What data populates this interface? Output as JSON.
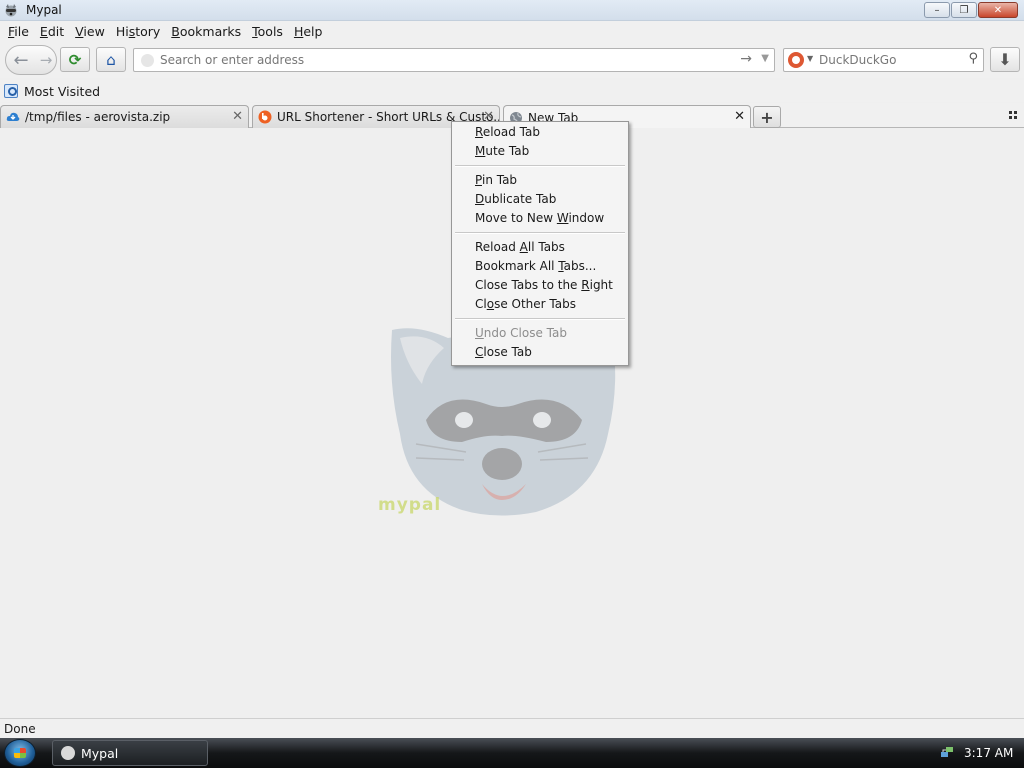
{
  "window": {
    "title": "Mypal",
    "buttons": {
      "minimize": "–",
      "restore": "❐",
      "close": "✕"
    }
  },
  "menubar": {
    "items": [
      {
        "label": "File",
        "mnemonic": "F",
        "rest": "ile"
      },
      {
        "label": "Edit",
        "mnemonic": "E",
        "rest": "dit"
      },
      {
        "label": "View",
        "mnemonic": "V",
        "rest": "iew"
      },
      {
        "label": "History",
        "pre": "Hi",
        "mnemonic": "s",
        "rest": "tory"
      },
      {
        "label": "Bookmarks",
        "mnemonic": "B",
        "rest": "ookmarks"
      },
      {
        "label": "Tools",
        "mnemonic": "T",
        "rest": "ools"
      },
      {
        "label": "Help",
        "mnemonic": "H",
        "rest": "elp"
      }
    ]
  },
  "navbar": {
    "url_placeholder": "Search or enter address",
    "url_value": "",
    "search_engine": "DuckDuckGo",
    "search_placeholder": "DuckDuckGo"
  },
  "bookmarks": {
    "most_visited": "Most Visited"
  },
  "tabs": [
    {
      "title": "/tmp/files - aerovista.zip",
      "icon": "cloud-icon",
      "active": false
    },
    {
      "title": "URL Shortener - Short URLs & Custo...",
      "icon": "bitly-icon",
      "active": false
    },
    {
      "title": "New Tab",
      "icon": "globe-icon",
      "active": true
    }
  ],
  "content": {
    "logo_text": "mypal"
  },
  "context_menu": {
    "groups": [
      [
        {
          "pre": "",
          "key": "R",
          "post": "eload Tab",
          "disabled": false
        },
        {
          "pre": "",
          "key": "M",
          "post": "ute Tab",
          "disabled": false
        }
      ],
      [
        {
          "pre": "",
          "key": "P",
          "post": "in Tab",
          "disabled": false
        },
        {
          "pre": "",
          "key": "D",
          "post": "ublicate Tab",
          "disabled": false
        },
        {
          "pre": "Move to New ",
          "key": "W",
          "post": "indow",
          "disabled": false
        }
      ],
      [
        {
          "pre": "Reload ",
          "key": "A",
          "post": "ll Tabs",
          "disabled": false
        },
        {
          "pre": "Bookmark All ",
          "key": "T",
          "post": "abs...",
          "disabled": false
        },
        {
          "pre": "Close Tabs to the ",
          "key": "R",
          "post": "ight",
          "disabled": false
        },
        {
          "pre": "Cl",
          "key": "o",
          "post": "se Other Tabs",
          "disabled": false
        }
      ],
      [
        {
          "pre": "",
          "key": "U",
          "post": "ndo Close Tab",
          "disabled": true
        },
        {
          "pre": "",
          "key": "C",
          "post": "lose Tab",
          "disabled": false
        }
      ]
    ]
  },
  "status": {
    "text": "Done"
  },
  "taskbar": {
    "app_label": "Mypal",
    "clock": "3:17 AM"
  }
}
